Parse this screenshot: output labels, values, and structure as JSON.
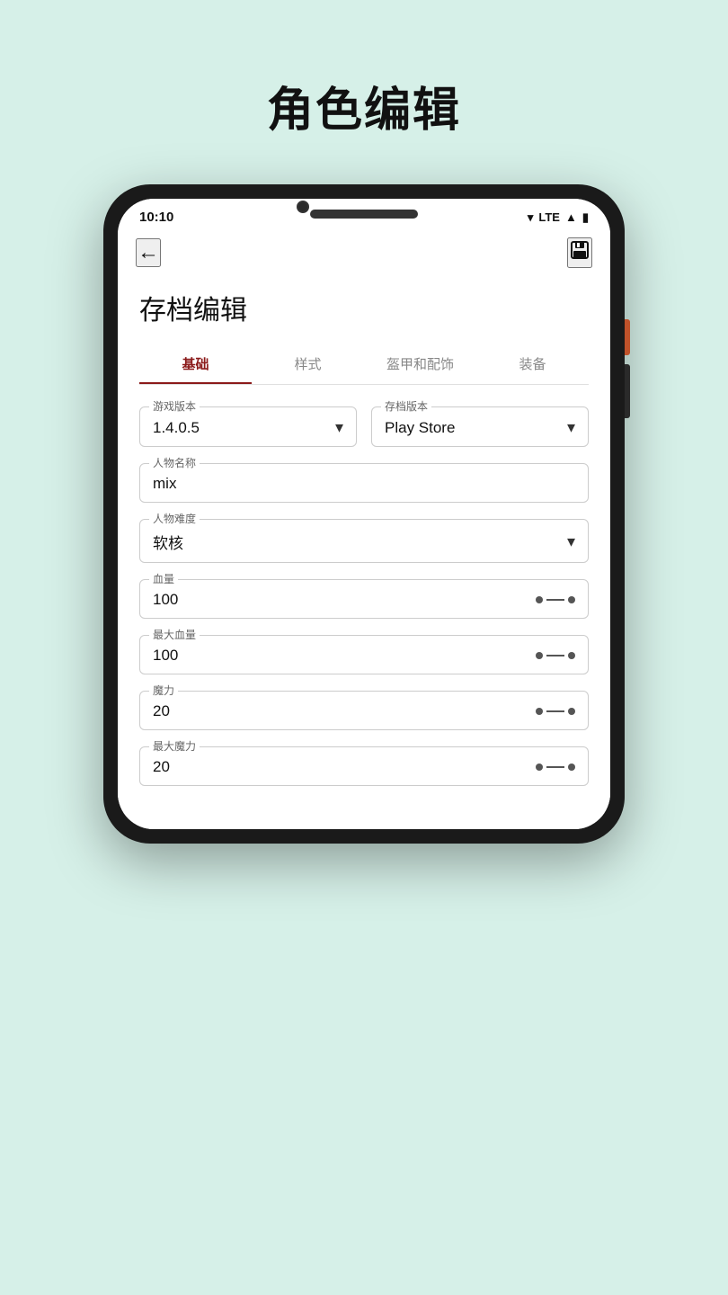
{
  "page": {
    "title": "角色编辑",
    "background": "#d6f0e8"
  },
  "status_bar": {
    "time": "10:10",
    "lte_label": "LTE",
    "wifi_symbol": "▼",
    "signal_symbol": "▲",
    "battery_symbol": "🔋"
  },
  "top_bar": {
    "back_symbol": "←",
    "save_symbol": "💾"
  },
  "form": {
    "section_title": "存档编辑",
    "tabs": [
      {
        "label": "基础",
        "active": true
      },
      {
        "label": "样式",
        "active": false
      },
      {
        "label": "盔甲和配饰",
        "active": false
      },
      {
        "label": "装备",
        "active": false
      }
    ],
    "fields": {
      "game_version_label": "游戏版本",
      "game_version_value": "1.4.0.5",
      "save_version_label": "存档版本",
      "save_version_value": "Play Store",
      "character_name_label": "人物名称",
      "character_name_value": "mix",
      "difficulty_label": "人物难度",
      "difficulty_value": "软核",
      "hp_label": "血量",
      "hp_value": "100",
      "max_hp_label": "最大血量",
      "max_hp_value": "100",
      "mana_label": "魔力",
      "mana_value": "20",
      "max_mana_label": "最大魔力",
      "max_mana_value": "20"
    }
  }
}
